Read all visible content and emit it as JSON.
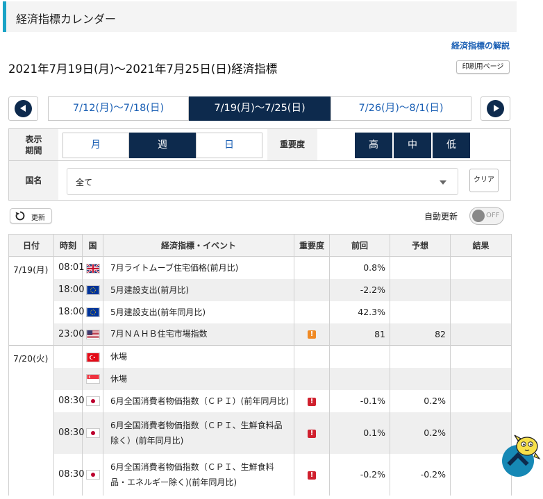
{
  "page": {
    "title": "経済指標カレンダー",
    "guide_link": "経済指標の解説",
    "period_title": "2021年7月19日(月)〜2021年7月25日(日)経済指標",
    "print_button": "印刷用ページ"
  },
  "week_nav": {
    "tabs": [
      {
        "label": "7/12(月)〜7/18(日)",
        "active": false
      },
      {
        "label": "7/19(月)〜7/25(日)",
        "active": true
      },
      {
        "label": "7/26(月)〜8/1(日)",
        "active": false
      }
    ]
  },
  "filters": {
    "display_period_label": "表示\n期間",
    "period_options": [
      {
        "label": "月",
        "active": false
      },
      {
        "label": "週",
        "active": true
      },
      {
        "label": "日",
        "active": false
      }
    ],
    "importance_label": "重要度",
    "importance_options": [
      {
        "label": "高",
        "active": true
      },
      {
        "label": "中",
        "active": true
      },
      {
        "label": "低",
        "active": true
      }
    ],
    "country_label": "国名",
    "country_value": "全て",
    "clear_button": "クリア"
  },
  "controls": {
    "refresh_button": "更新",
    "auto_update_label": "自動更新",
    "auto_update_state": "OFF"
  },
  "table": {
    "headers": [
      "日付",
      "時刻",
      "国",
      "経済指標・イベント",
      "重要度",
      "前回",
      "予想",
      "結果"
    ],
    "rows": [
      {
        "date": "7/19(月)",
        "time": "08:01",
        "flag": "uk-flag-icon",
        "event": "7月ライトムーブ住宅価格(前月比)",
        "importance": "",
        "prev": "0.8%",
        "forecast": "",
        "result": ""
      },
      {
        "date": "",
        "time": "18:00",
        "flag": "eu-flag-icon",
        "event": "5月建設支出(前月比)",
        "importance": "",
        "prev": "-2.2%",
        "forecast": "",
        "result": ""
      },
      {
        "date": "",
        "time": "18:00",
        "flag": "eu-flag-icon",
        "event": "5月建設支出(前年同月比)",
        "importance": "",
        "prev": "42.3%",
        "forecast": "",
        "result": ""
      },
      {
        "date": "",
        "time": "23:00",
        "flag": "us-flag-icon",
        "event": "7月ＮＡＨＢ住宅市場指数",
        "importance": "medium",
        "prev": "81",
        "forecast": "82",
        "result": ""
      },
      {
        "date": "7/20(火)",
        "time": "",
        "flag": "turkey-flag-icon",
        "event": "休場",
        "importance": "",
        "prev": "",
        "forecast": "",
        "result": ""
      },
      {
        "date": "",
        "time": "",
        "flag": "singapore-flag-icon",
        "event": "休場",
        "importance": "",
        "prev": "",
        "forecast": "",
        "result": ""
      },
      {
        "date": "",
        "time": "08:30",
        "flag": "japan-flag-icon",
        "event": "6月全国消費者物価指数（ＣＰＩ）(前年同月比)",
        "importance": "high",
        "prev": "-0.1%",
        "forecast": "0.2%",
        "result": ""
      },
      {
        "date": "",
        "time": "08:30",
        "flag": "japan-flag-icon",
        "event": "6月全国消費者物価指数（ＣＰＩ、生鮮食料品除く）(前年同月比)",
        "importance": "high",
        "prev": "0.1%",
        "forecast": "0.2%",
        "result": ""
      },
      {
        "date": "",
        "time": "08:30",
        "flag": "japan-flag-icon",
        "event": "6月全国消費者物価指数（ＣＰＩ、生鮮食料品・エネルギー除く)(前年同月比)",
        "importance": "high",
        "prev": "-0.2%",
        "forecast": "-0.2%",
        "result": ""
      }
    ]
  },
  "colors": {
    "navy": "#0d2a4d",
    "accent_blue": "#1a5fb4",
    "title_stripe": "#1aa3c6",
    "importance_high": "#d0202e",
    "importance_medium": "#f08a24",
    "importance_mark": "!"
  }
}
